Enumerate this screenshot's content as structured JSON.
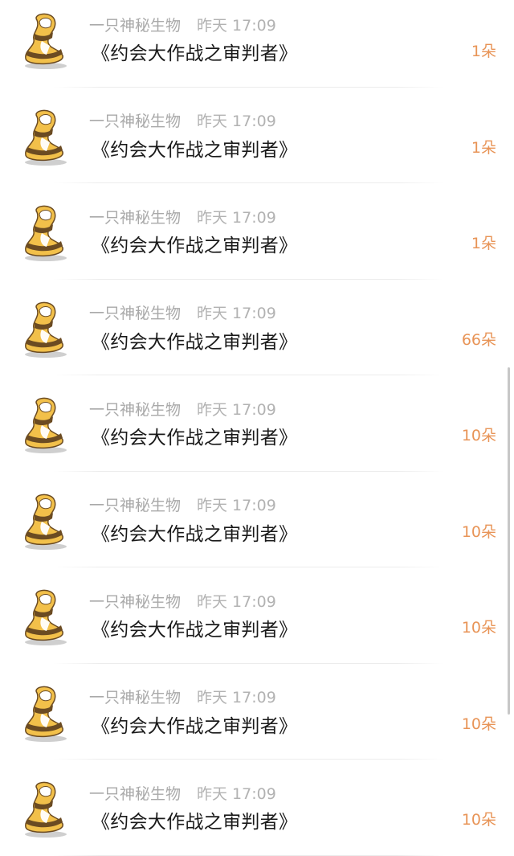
{
  "rows": [
    {
      "username": "一只神秘生物",
      "time": "昨天 17:09",
      "gift_title": "《约会大作战之审判者》",
      "count": "1朵"
    },
    {
      "username": "一只神秘生物",
      "time": "昨天 17:09",
      "gift_title": "《约会大作战之审判者》",
      "count": "1朵"
    },
    {
      "username": "一只神秘生物",
      "time": "昨天 17:09",
      "gift_title": "《约会大作战之审判者》",
      "count": "1朵"
    },
    {
      "username": "一只神秘生物",
      "time": "昨天 17:09",
      "gift_title": "《约会大作战之审判者》",
      "count": "66朵"
    },
    {
      "username": "一只神秘生物",
      "time": "昨天 17:09",
      "gift_title": "《约会大作战之审判者》",
      "count": "10朵"
    },
    {
      "username": "一只神秘生物",
      "time": "昨天 17:09",
      "gift_title": "《约会大作战之审判者》",
      "count": "10朵"
    },
    {
      "username": "一只神秘生物",
      "time": "昨天 17:09",
      "gift_title": "《约会大作战之审判者》",
      "count": "10朵"
    },
    {
      "username": "一只神秘生物",
      "time": "昨天 17:09",
      "gift_title": "《约会大作战之审判者》",
      "count": "10朵"
    },
    {
      "username": "一只神秘生物",
      "time": "昨天 17:09",
      "gift_title": "《约会大作战之审判者》",
      "count": "10朵"
    }
  ],
  "avatar_icon": "sandworm-mascot-icon",
  "colors": {
    "count": "#e89457",
    "meta": "#a9a9a9",
    "title": "#1a1a1a",
    "avatar_yellow": "#f2c04a",
    "avatar_brown": "#6b4b22"
  }
}
